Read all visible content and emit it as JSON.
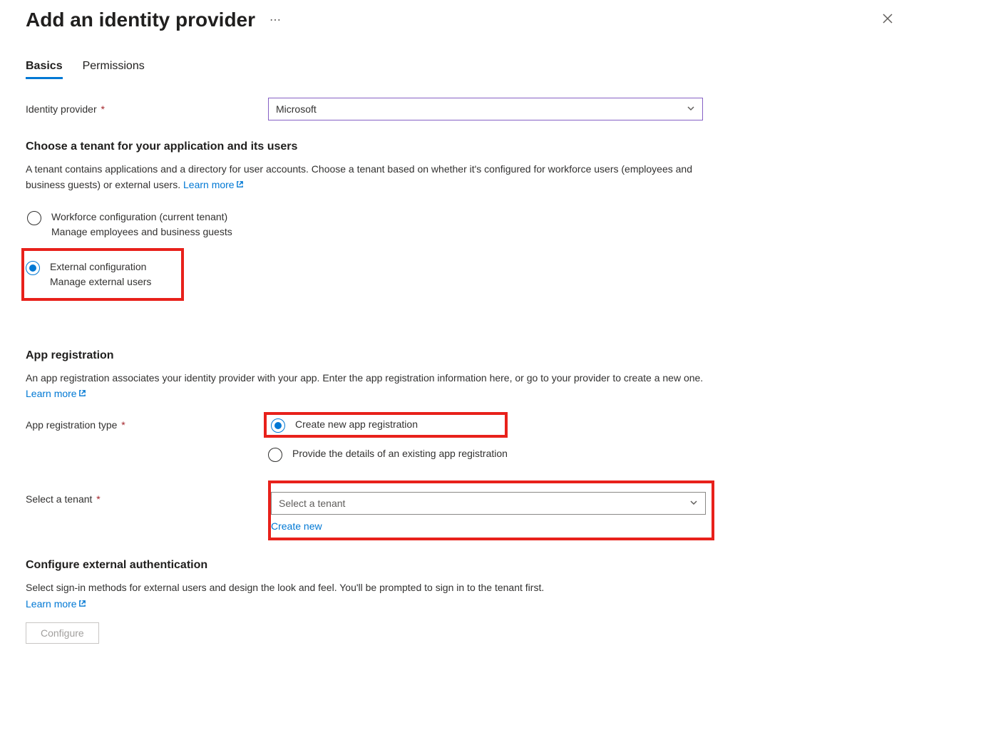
{
  "header": {
    "title": "Add an identity provider"
  },
  "tabs": {
    "basics": "Basics",
    "permissions": "Permissions"
  },
  "identityProvider": {
    "label": "Identity provider",
    "value": "Microsoft"
  },
  "tenantSection": {
    "heading": "Choose a tenant for your application and its users",
    "description": "A tenant contains applications and a directory for user accounts. Choose a tenant based on whether it's configured for workforce users (employees and business guests) or external users. ",
    "learnMore": "Learn more",
    "options": {
      "workforce": {
        "label": "Workforce configuration (current tenant)",
        "sublabel": "Manage employees and business guests"
      },
      "external": {
        "label": "External configuration",
        "sublabel": "Manage external users"
      }
    }
  },
  "appReg": {
    "heading": "App registration",
    "description": "An app registration associates your identity provider with your app. Enter the app registration information here, or go to your provider to create a new one. ",
    "learnMore": "Learn more",
    "typeLabel": "App registration type",
    "options": {
      "createNew": "Create new app registration",
      "existing": "Provide the details of an existing app registration"
    }
  },
  "selectTenant": {
    "label": "Select a tenant",
    "placeholder": "Select a tenant",
    "createNew": "Create new"
  },
  "extAuth": {
    "heading": "Configure external authentication",
    "description": "Select sign-in methods for external users and design the look and feel. You'll be prompted to sign in to the tenant first.",
    "learnMore": "Learn more",
    "configure": "Configure"
  }
}
